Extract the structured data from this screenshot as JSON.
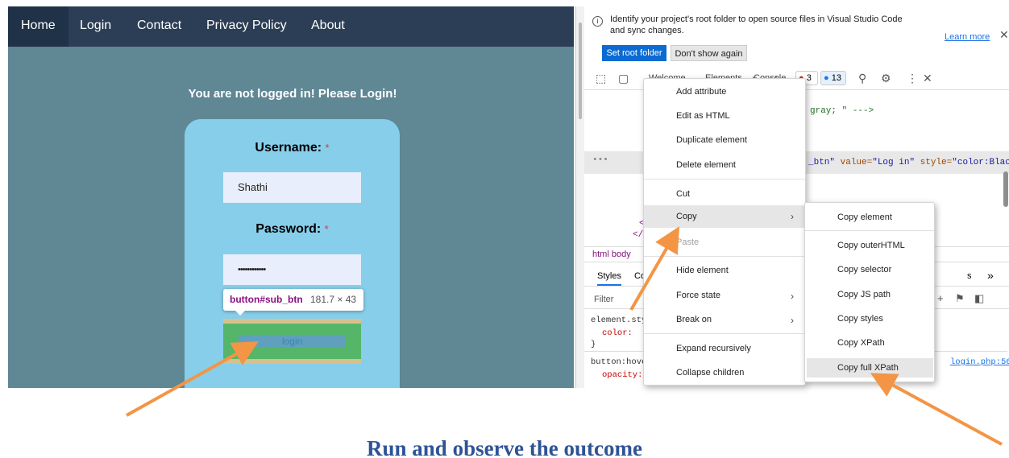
{
  "webpage": {
    "nav": [
      "Home",
      "Login",
      "Contact",
      "Privacy Policy",
      "About"
    ],
    "not_logged_msg": "You are not logged in! Please Login!",
    "username_label": "Username:",
    "password_label": "Password:",
    "required_mark": "*",
    "username_value": "Shathi",
    "password_value": "••••••••••••",
    "tooltip_selector": "button#sub_btn",
    "tooltip_size": "181.7 × 43",
    "login_button": "login"
  },
  "devtools": {
    "banner_text": "Identify your project's root folder to open source files in Visual Studio Code and sync changes.",
    "learn_more": "Learn more",
    "set_root": "Set root folder",
    "dont_show": "Don't show again",
    "tabs": [
      "Welcome",
      "Elements",
      "Console"
    ],
    "errors": "3",
    "messages": "13",
    "code_comment": "gray; \" --->",
    "code_selected_pre": "_btn\"",
    "code_value_attr": "value=",
    "code_value": "\"Log in\"",
    "code_style_attr": "style=",
    "code_style": "\"color:Blac",
    "code_close_tag": "</c",
    "code_lt": "<",
    "ellipsis": "•••",
    "breadcrumb": "html  body",
    "styles_tab": "Styles",
    "computed_tab_fragment": "Co",
    "layout_tab_fragment": "s",
    "filter": "Filter",
    "rule1": "element.sty",
    "rule1_prop": "color:",
    "rule1_close": "}",
    "rule2": "button:hove",
    "rule2_prop": "opacity:",
    "source_link": "login.php:56"
  },
  "context_menu": {
    "items": [
      "Add attribute",
      "Edit as HTML",
      "Duplicate element",
      "Delete element",
      "Cut",
      "Copy",
      "Paste",
      "Hide element",
      "Force state",
      "Break on",
      "Expand recursively",
      "Collapse children"
    ]
  },
  "copy_submenu": {
    "items": [
      "Copy element",
      "Copy outerHTML",
      "Copy selector",
      "Copy JS path",
      "Copy styles",
      "Copy XPath",
      "Copy full XPath"
    ]
  },
  "caption": "Run and observe the outcome",
  "colors": {
    "arrow": "#f39545",
    "nav_bg": "#2b3e55",
    "page_bg": "#5f8794",
    "card_bg": "#87ceeb"
  }
}
